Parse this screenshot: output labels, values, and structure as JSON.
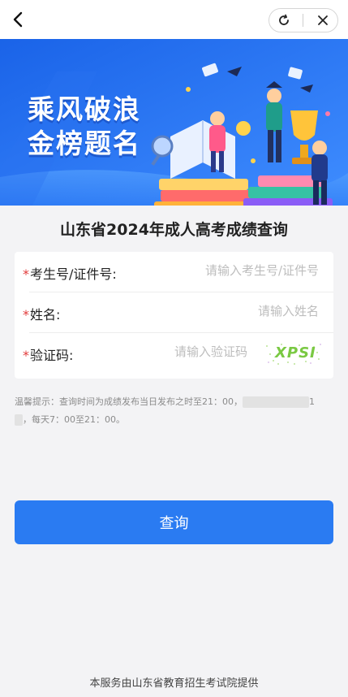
{
  "nav": {
    "back_icon": "chevron-left-icon",
    "capsule_icons": [
      "refresh-icon",
      "close-icon"
    ]
  },
  "banner": {
    "line1": "乘风破浪",
    "line2": "金榜题名",
    "colors": {
      "bg_top": "#1e6ff0",
      "bg_bottom": "#3c8cff",
      "text": "#ffffff"
    }
  },
  "page": {
    "title": "山东省2024年成人高考成绩查询"
  },
  "form": {
    "fields": [
      {
        "label": "考生号/证件号:",
        "placeholder": "请输入考生号/证件号",
        "value": ""
      },
      {
        "label": "姓名:",
        "placeholder": "请输入姓名",
        "value": ""
      },
      {
        "label": "验证码:",
        "placeholder": "请输入验证码",
        "value": ""
      }
    ],
    "required_mark": "*",
    "captcha_text": "XPSI"
  },
  "tip": {
    "line1": "温馨提示：查询时间为成绩发布当日发布之时至21：00，",
    "line1_end": "1",
    "line2": "，每天7：00至21：00。"
  },
  "submit": {
    "label": "查询",
    "color": "#2a7bf2"
  },
  "footer": {
    "text": "本服务由山东省教育招生考试院提供"
  }
}
